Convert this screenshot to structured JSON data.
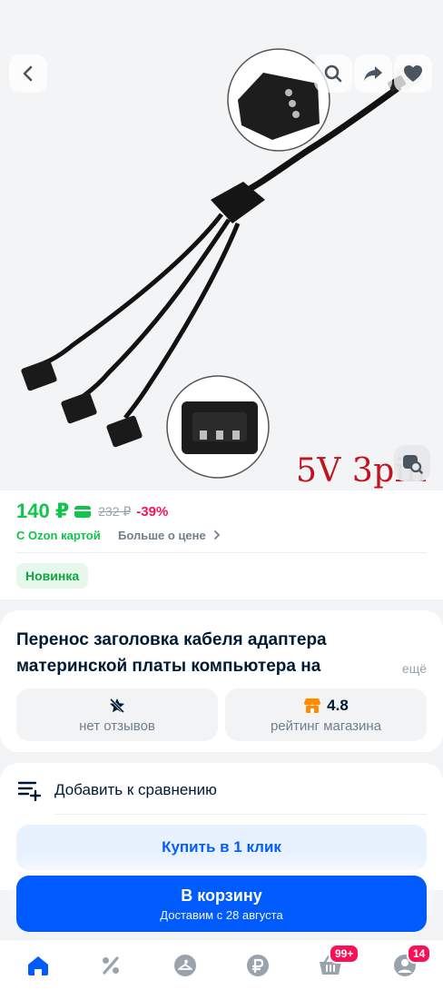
{
  "product": {
    "image_label": "5V 3pin",
    "price": "140 ₽",
    "old_price": "232 ₽",
    "discount": "-39%",
    "ozon_card_label": "С Ozon картой",
    "more_about_price": "Больше о цене",
    "badge": "Новинка",
    "title": "Перенос заголовка кабеля адаптера материнской платы компьютера на",
    "title_more": "ещё"
  },
  "stats": {
    "reviews_label": "нет отзывов",
    "rating_value": "4.8",
    "rating_label": "рейтинг магазина"
  },
  "actions": {
    "compare_label": "Добавить к сравнению",
    "quick_buy_label": "Купить в 1 клик",
    "cart_label": "В корзину",
    "cart_sub": "Доставим с 28 августа"
  },
  "tabbar": {
    "cart_badge": "99+",
    "profile_badge": "14"
  },
  "colors": {
    "accent": "#005bff",
    "green": "#10c44c",
    "discount": "#f91155"
  }
}
